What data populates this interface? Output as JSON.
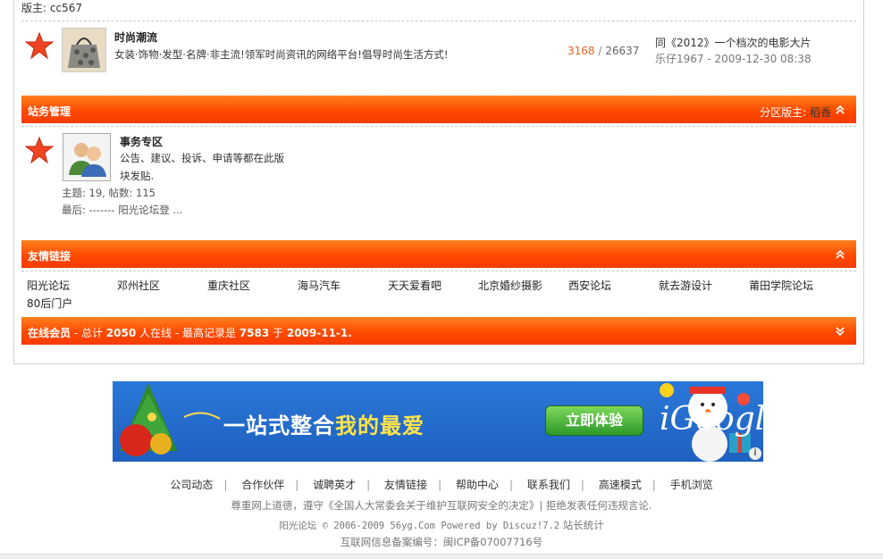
{
  "forum_section_1": {
    "moderator_line": "版主: cc567",
    "forum": {
      "title": "时尚潮流",
      "description": "女装·饰物·发型·名牌·非主流!领军时尚资讯的网络平台!倡导时尚生活方式!",
      "today_posts": "3168",
      "separator": "/",
      "total_posts": "26637",
      "last_post_title": "同《2012》一个档次的电影大片",
      "last_post_meta": "乐仔1967 - 2009-12-30 08:38"
    }
  },
  "section_admin": {
    "title": "站务管理",
    "moderator_label": "分区版主:",
    "moderator_name": "稻香",
    "forum": {
      "title": "事务专区",
      "desc_line1": "公告、建议、投诉、申请等都在此版",
      "desc_line2": "块发贴.",
      "stats": "主题: 19, 帖数: 115",
      "last": "最后: ------- 阳光论坛登 ..."
    }
  },
  "friend_links": {
    "title": "友情链接",
    "links": [
      "阳光论坛",
      "邓州社区",
      "重庆社区",
      "海马汽车",
      "天天爱看吧",
      "北京婚纱摄影",
      "西安论坛",
      "就去游设计",
      "莆田学院论坛",
      "80后门户"
    ]
  },
  "online": {
    "label": "在线会员",
    "t1": " - 总计 ",
    "total": "2050",
    "t2": " 人在线 - 最高记录是 ",
    "record": "7583",
    "t3": " 于 ",
    "date": "2009-11-1."
  },
  "banner": {
    "slogan_a": "一站式整合",
    "slogan_b": "我的最爱",
    "cta": "立即体验",
    "brand": "iGoogle",
    "info": "i"
  },
  "footer": {
    "nav": [
      "公司动态",
      "合作伙伴",
      "诚聘英才",
      "友情链接",
      "帮助中心",
      "联系我们",
      "高速模式",
      "手机浏览"
    ],
    "notice": "尊重网上道德，遵守《全国人大常委会关于维护互联网安全的决定》| 拒绝发表任何违规言论.",
    "copyright_a": "阳光论坛 © 2006-2009 56yg.Com Powered by Discuz!7.2",
    "stats_link": "站长统计",
    "icp": "互联网信息备案编号：闽ICP备07007716号"
  },
  "colors": {
    "bar_orange": "#ff5a0a",
    "hot_number": "#e8601c",
    "star_red": "#e83a1a"
  },
  "icons": {
    "star": "star-icon",
    "collapse": "chevron-up-double-icon",
    "expand": "chevron-down-double-icon"
  }
}
